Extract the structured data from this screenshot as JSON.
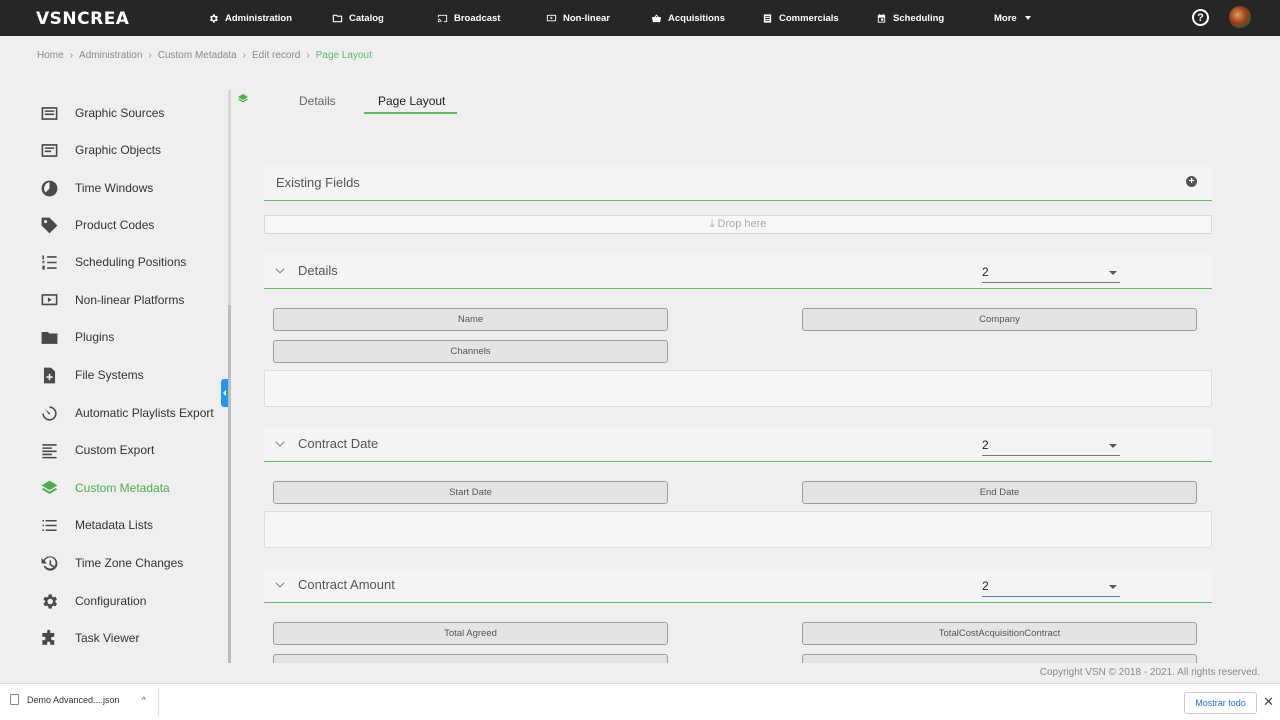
{
  "app": {
    "logo": "VSNCREA"
  },
  "nav": {
    "items": [
      {
        "label": "Administration",
        "icon": "gear-icon"
      },
      {
        "label": "Catalog",
        "icon": "folder-icon"
      },
      {
        "label": "Broadcast",
        "icon": "cast-icon"
      },
      {
        "label": "Non-linear",
        "icon": "play-screen-icon"
      },
      {
        "label": "Acquisitions",
        "icon": "basket-icon"
      },
      {
        "label": "Commercials",
        "icon": "list-icon"
      },
      {
        "label": "Scheduling",
        "icon": "calendar-icon"
      },
      {
        "label": "More",
        "icon": "caret-down-icon"
      }
    ],
    "help": "?"
  },
  "breadcrumb": [
    "Home",
    "Administration",
    "Custom Metadata",
    "Edit record",
    "Page Layout"
  ],
  "sidebar": {
    "items": [
      {
        "label": "Graphic Sources",
        "icon": "graphic-sources-icon"
      },
      {
        "label": "Graphic Objects",
        "icon": "graphic-objects-icon"
      },
      {
        "label": "Time Windows",
        "icon": "clock-icon"
      },
      {
        "label": "Product Codes",
        "icon": "tag-icon"
      },
      {
        "label": "Scheduling Positions",
        "icon": "ordered-list-icon"
      },
      {
        "label": "Non-linear Platforms",
        "icon": "play-screen-icon"
      },
      {
        "label": "Plugins",
        "icon": "folder-icon"
      },
      {
        "label": "File Systems",
        "icon": "file-add-icon"
      },
      {
        "label": "Automatic Playlists Export",
        "icon": "timer-icon"
      },
      {
        "label": "Custom Export",
        "icon": "align-left-icon"
      },
      {
        "label": "Custom Metadata",
        "icon": "layers-icon",
        "active": true
      },
      {
        "label": "Metadata Lists",
        "icon": "bullet-list-icon"
      },
      {
        "label": "Time Zone Changes",
        "icon": "history-icon"
      },
      {
        "label": "Configuration",
        "icon": "gear-icon"
      },
      {
        "label": "Task Viewer",
        "icon": "puzzle-icon"
      }
    ]
  },
  "tabs": [
    {
      "label": "Details",
      "active": false
    },
    {
      "label": "Page Layout",
      "active": true
    }
  ],
  "existing_fields": {
    "title": "Existing Fields",
    "add_icon": "plus-circle-icon"
  },
  "dropzone": {
    "label": "⤓ Drop here"
  },
  "sections": [
    {
      "title": "Details",
      "columns": "2",
      "fields": [
        "Name",
        "Company",
        "Channels"
      ]
    },
    {
      "title": "Contract Date",
      "columns": "2",
      "fields": [
        "Start Date",
        "End Date"
      ]
    },
    {
      "title": "Contract Amount",
      "columns": "2",
      "fields": [
        "Total Agreed",
        "TotalCostAcquisitionContract"
      ]
    }
  ],
  "footer": {
    "copyright": "Copyright VSN © 2018 - 2021. All rights reserved."
  },
  "download_bar": {
    "file_name": "Demo Advanced....json",
    "show_all": "Mostrar todo",
    "close": "✕"
  },
  "colors": {
    "accent": "#5cbf5c",
    "topbar": "#262626",
    "handle": "#2196f3"
  }
}
